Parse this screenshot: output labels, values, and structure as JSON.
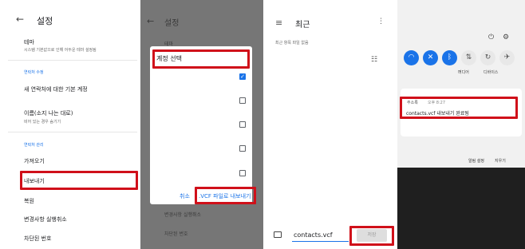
{
  "settings": {
    "title": "설정",
    "theme_title": "테마",
    "theme_desc": "시스템 기본값으로 인해 어두운 테마 설정됨",
    "section_contact_edit": "연락처 수정",
    "default_account": "새 연락처에 대한 기본 계정",
    "name_format_title": "이름(소지 나는 대로)",
    "name_format_desc": "비어 있는 경우 숨기기",
    "section_contact_manage": "연락처 관리",
    "import": "가져오기",
    "export": "내보내기",
    "restore": "복원",
    "undo_changes": "변경사항 실행취소",
    "blocked_numbers": "차단된 번호"
  },
  "dialog": {
    "header_dim": "설정",
    "bg_text_1": "테마",
    "bg_text_2": "변경사항 실행취소",
    "bg_text_3": "차단된 번호",
    "title": "계정 선택",
    "cancel": "취소",
    "export_button": ".VCF 파일로 내보내기",
    "checkbox_checked": [
      true,
      false,
      false,
      false,
      false
    ]
  },
  "save": {
    "title": "최근",
    "subtitle": "최근 항목 파일 없음",
    "filename": "contacts.vcf",
    "save_button": "저장"
  },
  "shade": {
    "quick_tiles": [
      "wifi-icon",
      "mute-icon",
      "bluetooth-icon",
      "data-icon",
      "rotate-icon",
      "airplane-icon"
    ],
    "tile_label_1": "미디어",
    "tile_label_2": "디바이스",
    "notification_app": "주소록",
    "notification_time": "오후 8:27",
    "notification_text": "contacts.vcf 내보내기 완료됨",
    "notification_settings": "알림 설정",
    "clear_all": "지우기"
  },
  "colors": {
    "highlight": "#d0101a",
    "accent": "#1a73e8"
  }
}
